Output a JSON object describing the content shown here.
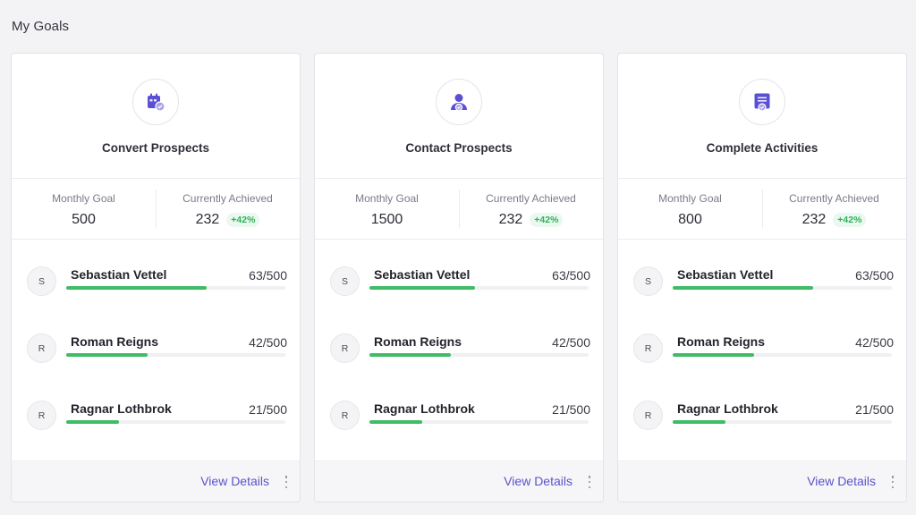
{
  "page": {
    "title": "My Goals"
  },
  "colors": {
    "accent": "#5b52c9",
    "progress": "#3fbc66",
    "positive": "#2fb35a"
  },
  "cards": [
    {
      "title": "Convert Prospects",
      "icon": "calendar-check-icon",
      "monthly_goal_label": "Monthly Goal",
      "monthly_goal": "500",
      "achieved_label": "Currently Achieved",
      "achieved": "232",
      "change": "+42%",
      "people": [
        {
          "initial": "S",
          "name": "Sebastian Vettel",
          "score": "63/500",
          "progress": 0.64
        },
        {
          "initial": "R",
          "name": "Roman Reigns",
          "score": "42/500",
          "progress": 0.37
        },
        {
          "initial": "R",
          "name": "Ragnar Lothbrok",
          "score": "21/500",
          "progress": 0.24
        }
      ],
      "view_details": "View Details"
    },
    {
      "title": "Contact Prospects",
      "icon": "user-check-icon",
      "monthly_goal_label": "Monthly Goal",
      "monthly_goal": "1500",
      "achieved_label": "Currently Achieved",
      "achieved": "232",
      "change": "+42%",
      "people": [
        {
          "initial": "S",
          "name": "Sebastian Vettel",
          "score": "63/500",
          "progress": 0.48
        },
        {
          "initial": "R",
          "name": "Roman Reigns",
          "score": "42/500",
          "progress": 0.37
        },
        {
          "initial": "R",
          "name": "Ragnar Lothbrok",
          "score": "21/500",
          "progress": 0.24
        }
      ],
      "view_details": "View Details"
    },
    {
      "title": "Complete Activities",
      "icon": "task-list-check-icon",
      "monthly_goal_label": "Monthly Goal",
      "monthly_goal": "800",
      "achieved_label": "Currently Achieved",
      "achieved": "232",
      "change": "+42%",
      "people": [
        {
          "initial": "S",
          "name": "Sebastian Vettel",
          "score": "63/500",
          "progress": 0.64
        },
        {
          "initial": "R",
          "name": "Roman Reigns",
          "score": "42/500",
          "progress": 0.37
        },
        {
          "initial": "R",
          "name": "Ragnar Lothbrok",
          "score": "21/500",
          "progress": 0.24
        }
      ],
      "view_details": "View Details"
    }
  ]
}
